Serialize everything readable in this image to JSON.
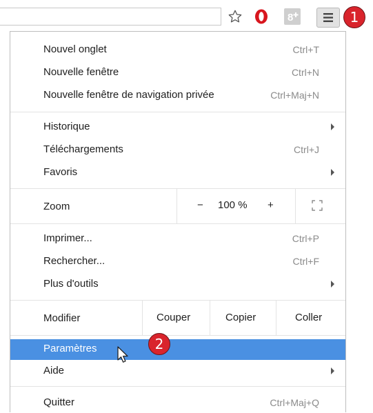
{
  "markers": {
    "one": "1",
    "two": "2"
  },
  "icons": {
    "star": "star-icon",
    "opera": "opera-icon",
    "gplus": "google-plus-icon",
    "menu": "hamburger-menu-icon",
    "fullscreen": "fullscreen-icon",
    "cursor": "mouse-pointer-icon"
  },
  "menu": {
    "group1": [
      {
        "label": "Nouvel onglet",
        "shortcut": "Ctrl+T"
      },
      {
        "label": "Nouvelle fenêtre",
        "shortcut": "Ctrl+N"
      },
      {
        "label": "Nouvelle fenêtre de navigation privée",
        "shortcut": "Ctrl+Maj+N"
      }
    ],
    "group2": [
      {
        "label": "Historique"
      },
      {
        "label": "Téléchargements",
        "shortcut": "Ctrl+J"
      },
      {
        "label": "Favoris"
      }
    ],
    "zoom": {
      "label": "Zoom",
      "minus": "−",
      "value": "100 %",
      "plus": "+"
    },
    "group3": [
      {
        "label": "Imprimer...",
        "shortcut": "Ctrl+P"
      },
      {
        "label": "Rechercher...",
        "shortcut": "Ctrl+F"
      },
      {
        "label": "Plus d'outils"
      }
    ],
    "edit": {
      "label": "Modifier",
      "cut": "Couper",
      "copy": "Copier",
      "paste": "Coller"
    },
    "settings": "Paramètres",
    "help": "Aide",
    "quit": {
      "label": "Quitter",
      "shortcut": "Ctrl+Maj+Q"
    }
  },
  "colors": {
    "highlight": "#4a90e2",
    "marker": "#d9242c"
  }
}
